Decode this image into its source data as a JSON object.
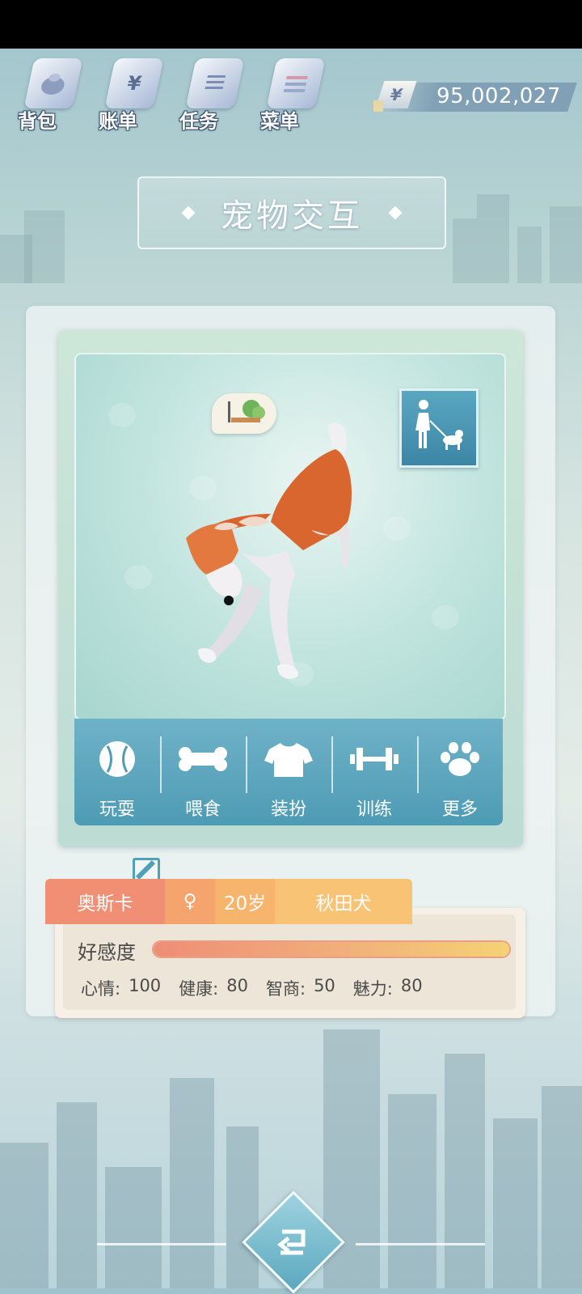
{
  "topnav": {
    "items": [
      {
        "label": "背包",
        "icon": "bag-icon"
      },
      {
        "label": "账单",
        "icon": "bill-icon"
      },
      {
        "label": "任务",
        "icon": "task-icon"
      },
      {
        "label": "菜单",
        "icon": "menu-icon"
      }
    ],
    "money": {
      "symbol": "¥",
      "value": "95,002,027"
    }
  },
  "title": "宠物交互",
  "actions": [
    {
      "label": "玩耍",
      "icon": "ball-icon"
    },
    {
      "label": "喂食",
      "icon": "bone-icon"
    },
    {
      "label": "装扮",
      "icon": "shirt-icon"
    },
    {
      "label": "训练",
      "icon": "dumbbell-icon"
    },
    {
      "label": "更多",
      "icon": "paw-icon"
    }
  ],
  "pet": {
    "name": "奥斯卡",
    "gender_symbol": "♀",
    "age": "20岁",
    "breed": "秋田犬",
    "affection_label": "好感度",
    "affection_fraction": 1.0,
    "stats": [
      {
        "label": "心情:",
        "value": "100"
      },
      {
        "label": "健康:",
        "value": "80"
      },
      {
        "label": "智商:",
        "value": "50"
      },
      {
        "label": "魅力:",
        "value": "80"
      }
    ]
  },
  "colors": {
    "accent": "#4e9bb5",
    "tag_name": "#f18f74",
    "tag_breed": "#f8c374"
  }
}
